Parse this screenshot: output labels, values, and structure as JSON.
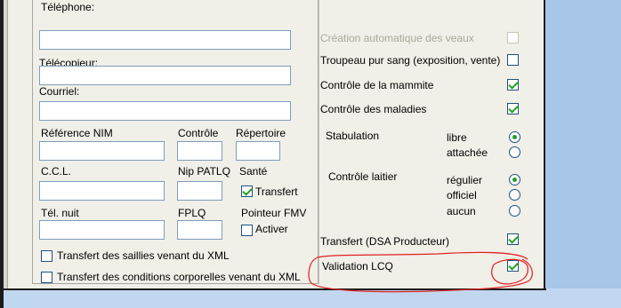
{
  "contact": {
    "telephone_label": "Téléphone:",
    "telephone_value": "",
    "fax_label": "Télécopieur:",
    "fax_value": "",
    "email_label": "Courriel:",
    "email_value": ""
  },
  "identifiers": {
    "nim_label": "Référence NIM",
    "controle_label": "Contrôle",
    "repertoire_label": "Répertoire",
    "ccl_label": "C.C.L.",
    "nip_label": "Nip PATLQ",
    "sante_label": "Santé",
    "transfert_label": "Transfert",
    "tel_nuit_label": "Tél. nuit",
    "fplq_label": "FPLQ",
    "pointeur_label": "Pointeur FMV",
    "activer_label": "Activer"
  },
  "left_checkboxes": {
    "saillies_label": "Transfert des saillies venant du XML",
    "conditions_label": "Transfert des conditions corporelles venant du XML"
  },
  "options": {
    "creation_veaux_label": "Création automatique des veaux",
    "troupeau_label": "Troupeau pur sang (exposition, vente)",
    "mammite_label": "Contrôle de la mammite",
    "maladies_label": "Contrôle des maladies",
    "stabulation_label": "Stabulation",
    "stab_libre_label": "libre",
    "stab_attachee_label": "attachée",
    "controle_laitier_label": "Contrôle laitier",
    "cl_regulier_label": "régulier",
    "cl_officiel_label": "officiel",
    "cl_aucun_label": "aucun",
    "transfert_dsa_label": "Transfert (DSA Producteur)",
    "validation_lcq_label": "Validation LCQ"
  },
  "colors": {
    "annotation": "#e02020",
    "check": "#21a121",
    "input_border": "#7f9db9",
    "desktop_blue": "#a7c6e8"
  }
}
